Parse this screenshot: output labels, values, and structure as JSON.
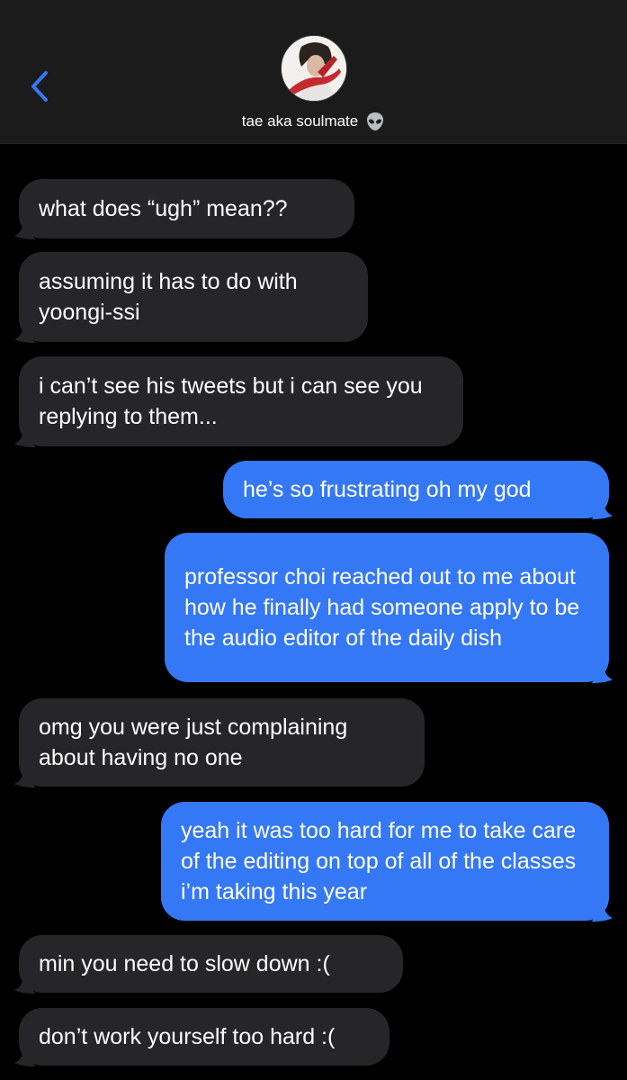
{
  "header": {
    "back_icon": "chevron-left-icon",
    "contact_name": "tae aka soulmate",
    "contact_emoji_icon": "alien-icon",
    "accent": "#3478f6"
  },
  "messages": [
    {
      "direction": "received",
      "text": "what does “ugh” mean??"
    },
    {
      "direction": "received",
      "text": "assuming it has to do with yoongi-ssi"
    },
    {
      "direction": "received",
      "text": "i can’t see his tweets but i can see you replying to them..."
    },
    {
      "direction": "sent",
      "text": "he’s so frustrating oh my god"
    },
    {
      "direction": "sent",
      "text": "professor choi reached out to me about how he finally had someone apply to be the audio editor of the daily dish"
    },
    {
      "direction": "received",
      "text": "omg you were just complaining about having no one"
    },
    {
      "direction": "sent",
      "text": "yeah it was too hard for me to take care of the editing on top of all of the classes i’m taking this year"
    },
    {
      "direction": "received",
      "text": "min you need to slow down :("
    },
    {
      "direction": "received",
      "text": "don’t work yourself too hard :("
    }
  ],
  "colors": {
    "sent_bubble": "#3478f6",
    "received_bubble": "#262628",
    "background": "#000000",
    "header": "#1b1b1b"
  }
}
